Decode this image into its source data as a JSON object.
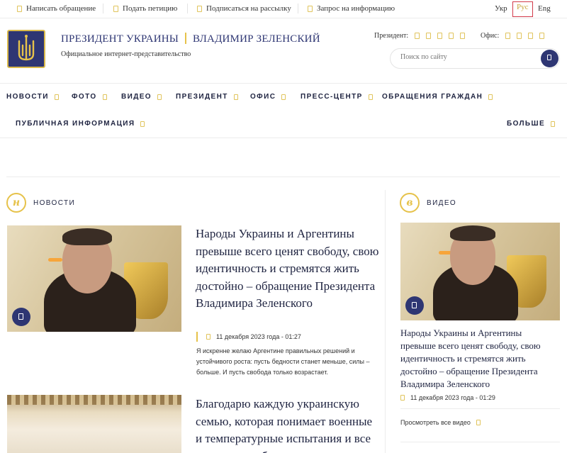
{
  "topbar": {
    "links": [
      "Написать обращение",
      "Подать петицию",
      "Подписаться на рассылку",
      "Запрос на информацию"
    ],
    "languages": [
      "Укр",
      "Рус",
      "Eng"
    ],
    "active_language": "Рус"
  },
  "header": {
    "title_left": "ПРЕЗИДЕНТ УКРАИНЫ",
    "title_right": "ВЛАДИМИР ЗЕЛЕНСКИЙ",
    "subtitle": "Официальное интернет-представительство",
    "social_president_label": "Президент:",
    "social_office_label": "Офис:",
    "search_placeholder": "Поиск по сайту"
  },
  "nav": {
    "row1": [
      "НОВОСТИ",
      "ФОТО",
      "ВИДЕО",
      "ПРЕЗИДЕНТ",
      "ОФИС",
      "ПРЕСС-ЦЕНТР",
      "ОБРАЩЕНИЯ ГРАЖДАН"
    ],
    "row2_left": "ПУБЛИЧНАЯ ИНФОРМАЦИЯ",
    "row2_right": "БОЛЬШЕ"
  },
  "news": {
    "section_label": "НОВОСТИ",
    "section_letter": "н",
    "item1_title": "Народы Украины и Аргентины превыше всего ценят свободу, свою идентичность и стремятся жить достойно – обращение Президента Владимира Зеленского",
    "item1_date": "11 декабря 2023 года - 01:27",
    "item1_excerpt": "Я искренне желаю Аргентине правильных решений и устойчивого роста: пусть бедности станет меньше, силы – больше. И пусть свобода только возрастает.",
    "item2_title": "Благодарю каждую украинскую семью, которая понимает военные и температурные испытания и все равно стоит, борется"
  },
  "video": {
    "section_label": "ВИДЕО",
    "section_letter": "в",
    "item_title": "Народы Украины и Аргентины превыше всего ценят свободу, свою идентичность и стремятся жить достойно – обращение Президента Владимира Зеленского",
    "item_date": "11 декабря 2023 года - 01:29",
    "all_label": "Просмотреть все видео"
  },
  "colors": {
    "brand_navy": "#2e3673",
    "accent_gold": "#e6c24a",
    "highlight_red": "#d23a4a"
  }
}
